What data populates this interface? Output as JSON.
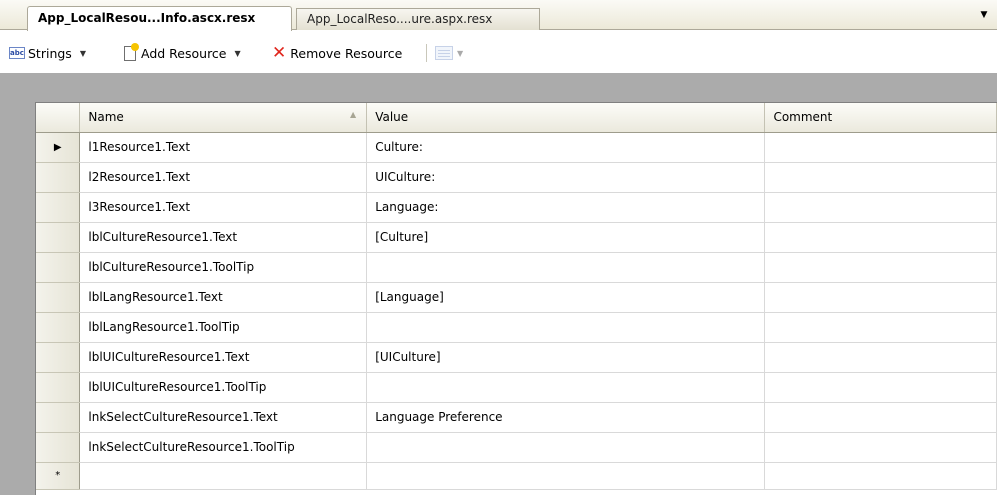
{
  "tabs": [
    {
      "label": "App_LocalResou...Info.ascx.resx",
      "active": true
    },
    {
      "label": "App_LocalReso....ure.aspx.resx",
      "active": false
    }
  ],
  "tab_menu_icon": "dropdown-arrow",
  "toolbar": {
    "strings_label": "Strings",
    "strings_icon_text": "abc",
    "add_label": "Add Resource",
    "remove_label": "Remove Resource"
  },
  "grid": {
    "columns": [
      "Name",
      "Value",
      "Comment"
    ],
    "current_row_marker": "▶",
    "new_row_marker": "*",
    "rows": [
      {
        "name": "l1Resource1.Text",
        "value": "Culture:",
        "comment": ""
      },
      {
        "name": "l2Resource1.Text",
        "value": "UICulture:",
        "comment": ""
      },
      {
        "name": "l3Resource1.Text",
        "value": "Language:",
        "comment": ""
      },
      {
        "name": "lblCultureResource1.Text",
        "value": "[Culture]",
        "comment": ""
      },
      {
        "name": "lblCultureResource1.ToolTip",
        "value": "",
        "comment": ""
      },
      {
        "name": "lblLangResource1.Text",
        "value": "[Language]",
        "comment": ""
      },
      {
        "name": "lblLangResource1.ToolTip",
        "value": "",
        "comment": ""
      },
      {
        "name": "lblUICultureResource1.Text",
        "value": "[UICulture]",
        "comment": ""
      },
      {
        "name": "lblUICultureResource1.ToolTip",
        "value": "",
        "comment": ""
      },
      {
        "name": "lnkSelectCultureResource1.Text",
        "value": "Language Preference",
        "comment": ""
      },
      {
        "name": "lnkSelectCultureResource1.ToolTip",
        "value": "",
        "comment": ""
      }
    ]
  },
  "colors": {
    "grid_background": "#ababab",
    "remove_icon": "#e0261d",
    "tab_border": "#aca899"
  }
}
